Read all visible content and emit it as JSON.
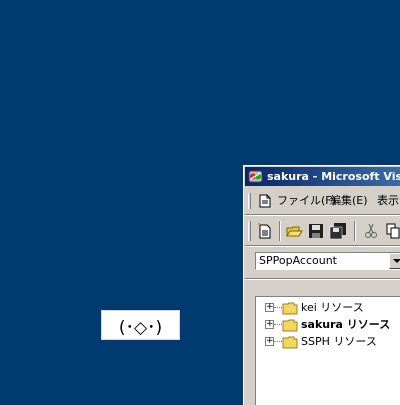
{
  "desktop": {
    "background_color": "#003A6E",
    "sticker_text": "(･◇･)"
  },
  "window": {
    "title": "sakura - Microsoft Visual",
    "title_bar_color": "#0A246A",
    "icon": "vb-app-icon",
    "menu": {
      "items": [
        {
          "label": "ファイル(F)"
        },
        {
          "label": "編集(E)"
        },
        {
          "label": "表示"
        }
      ]
    },
    "toolbar": {
      "buttons": [
        {
          "icon": "add-form-icon"
        },
        {
          "icon": "open-folder-icon"
        },
        {
          "icon": "save-icon"
        },
        {
          "icon": "save-all-icon"
        },
        {
          "icon": "cut-icon"
        },
        {
          "icon": "copy-icon"
        }
      ]
    },
    "combo": {
      "value": "SPPopAccount"
    },
    "tree": {
      "items": [
        {
          "label": "kei リソース",
          "bold": false,
          "expander": "+"
        },
        {
          "label": "sakura リソース",
          "bold": true,
          "expander": "+"
        },
        {
          "label": "SSPH リソース",
          "bold": false,
          "expander": "+"
        }
      ]
    }
  }
}
